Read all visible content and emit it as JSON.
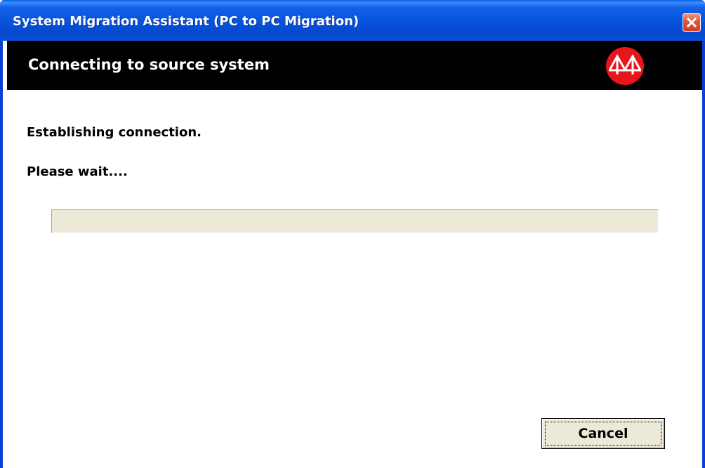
{
  "window": {
    "title": "System Migration Assistant (PC to PC Migration)",
    "close_icon": "close-icon",
    "title_bar_color": "#0855dd"
  },
  "header": {
    "title": "Connecting to source system",
    "logo_icon": "bridge-logo-icon",
    "background_color": "#000000",
    "logo_color": "#e8151b"
  },
  "main": {
    "status_line": "Establishing connection.",
    "wait_line": "Please wait....",
    "progress": {
      "percent": 0
    }
  },
  "buttons": {
    "cancel_label": "Cancel"
  }
}
